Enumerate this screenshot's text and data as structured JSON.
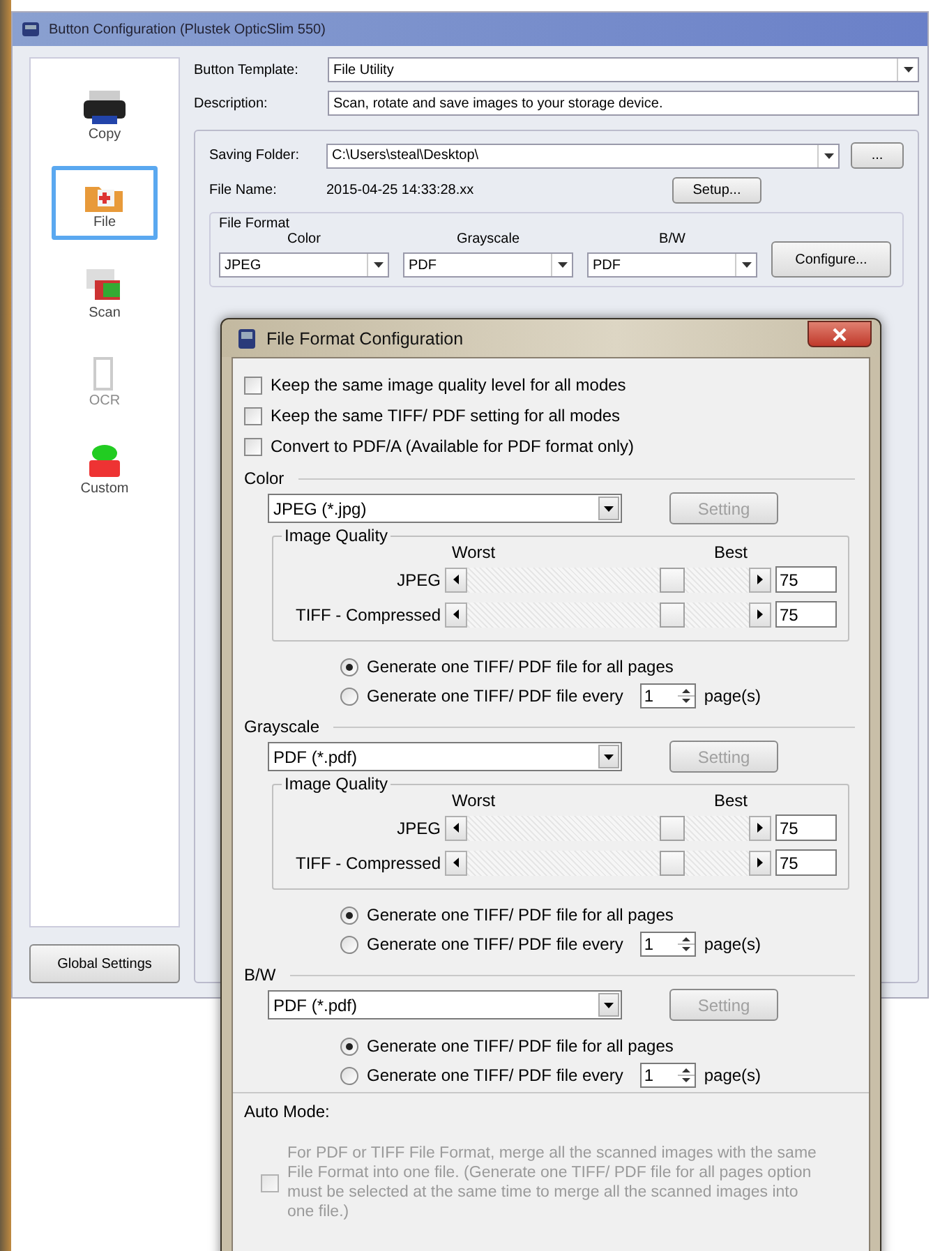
{
  "main_window": {
    "title": "Button Configuration (Plustek OpticSlim 550)",
    "sidebar": {
      "items": [
        {
          "label": "Copy",
          "kind": "copy",
          "selected": false,
          "disabled": false
        },
        {
          "label": "File",
          "kind": "file",
          "selected": true,
          "disabled": false
        },
        {
          "label": "Scan",
          "kind": "scan",
          "selected": false,
          "disabled": false
        },
        {
          "label": "OCR",
          "kind": "ocr",
          "selected": false,
          "disabled": true
        },
        {
          "label": "Custom",
          "kind": "custom",
          "selected": false,
          "disabled": false
        }
      ]
    },
    "global_settings_button": "Global Settings",
    "button_template": {
      "label": "Button Template:",
      "value": "File Utility"
    },
    "description": {
      "label": "Description:",
      "value": "Scan, rotate and save images to your storage device."
    },
    "saving_folder": {
      "label": "Saving Folder:",
      "value": "C:\\Users\\steal\\Desktop\\",
      "button": "..."
    },
    "file_name": {
      "label": "File Name:",
      "value": "2015-04-25 14:33:28.xx",
      "button": "Setup..."
    },
    "file_format": {
      "title": "File Format",
      "columns": [
        {
          "label": "Color",
          "value": "JPEG"
        },
        {
          "label": "Grayscale",
          "value": "PDF"
        },
        {
          "label": "B/W",
          "value": "PDF"
        }
      ],
      "button": "Configure..."
    }
  },
  "dialog": {
    "title": "File Format Configuration",
    "options": [
      {
        "label": "Keep the same image quality level for all modes",
        "checked": false
      },
      {
        "label": "Keep the same TIFF/ PDF setting for all modes",
        "checked": false
      },
      {
        "label": "Convert to PDF/A (Available for PDF format only)",
        "checked": false
      }
    ],
    "sections": [
      {
        "title": "Color",
        "format": "JPEG (*.jpg)",
        "setting_button": "Setting",
        "setting_disabled": true,
        "image_quality": {
          "title": "Image Quality",
          "worst": "Worst",
          "best": "Best",
          "rows": [
            {
              "label": "JPEG",
              "level": 0.75,
              "value": "75"
            },
            {
              "label": "TIFF - Compressed",
              "level": 0.75,
              "value": "75"
            }
          ]
        },
        "radios": [
          {
            "label": "Generate one TIFF/ PDF file for all pages",
            "selected": true
          },
          {
            "label": "Generate one TIFF/ PDF file every",
            "selected": false,
            "count": "1",
            "suffix": "page(s)"
          }
        ]
      },
      {
        "title": "Grayscale",
        "format": "PDF (*.pdf)",
        "setting_button": "Setting",
        "setting_disabled": true,
        "image_quality": {
          "title": "Image Quality",
          "worst": "Worst",
          "best": "Best",
          "rows": [
            {
              "label": "JPEG",
              "level": 0.75,
              "value": "75"
            },
            {
              "label": "TIFF - Compressed",
              "level": 0.75,
              "value": "75"
            }
          ]
        },
        "radios": [
          {
            "label": "Generate one TIFF/ PDF file for all pages",
            "selected": true
          },
          {
            "label": "Generate one TIFF/ PDF file every",
            "selected": false,
            "count": "1",
            "suffix": "page(s)"
          }
        ]
      },
      {
        "title": "B/W",
        "format": "PDF (*.pdf)",
        "setting_button": "Setting",
        "setting_disabled": true,
        "radios": [
          {
            "label": "Generate one TIFF/ PDF file for all pages",
            "selected": true
          },
          {
            "label": "Generate one TIFF/ PDF file every",
            "selected": false,
            "count": "1",
            "suffix": "page(s)"
          }
        ]
      }
    ],
    "auto_mode": {
      "label": "Auto Mode:",
      "option": {
        "text": "For PDF or TIFF File Format, merge all the scanned images with the same File Format into one file. (Generate one TIFF/ PDF file for all pages option must be selected at the same time to merge all the scanned images into one file.)",
        "checked": false,
        "disabled": true
      }
    }
  }
}
